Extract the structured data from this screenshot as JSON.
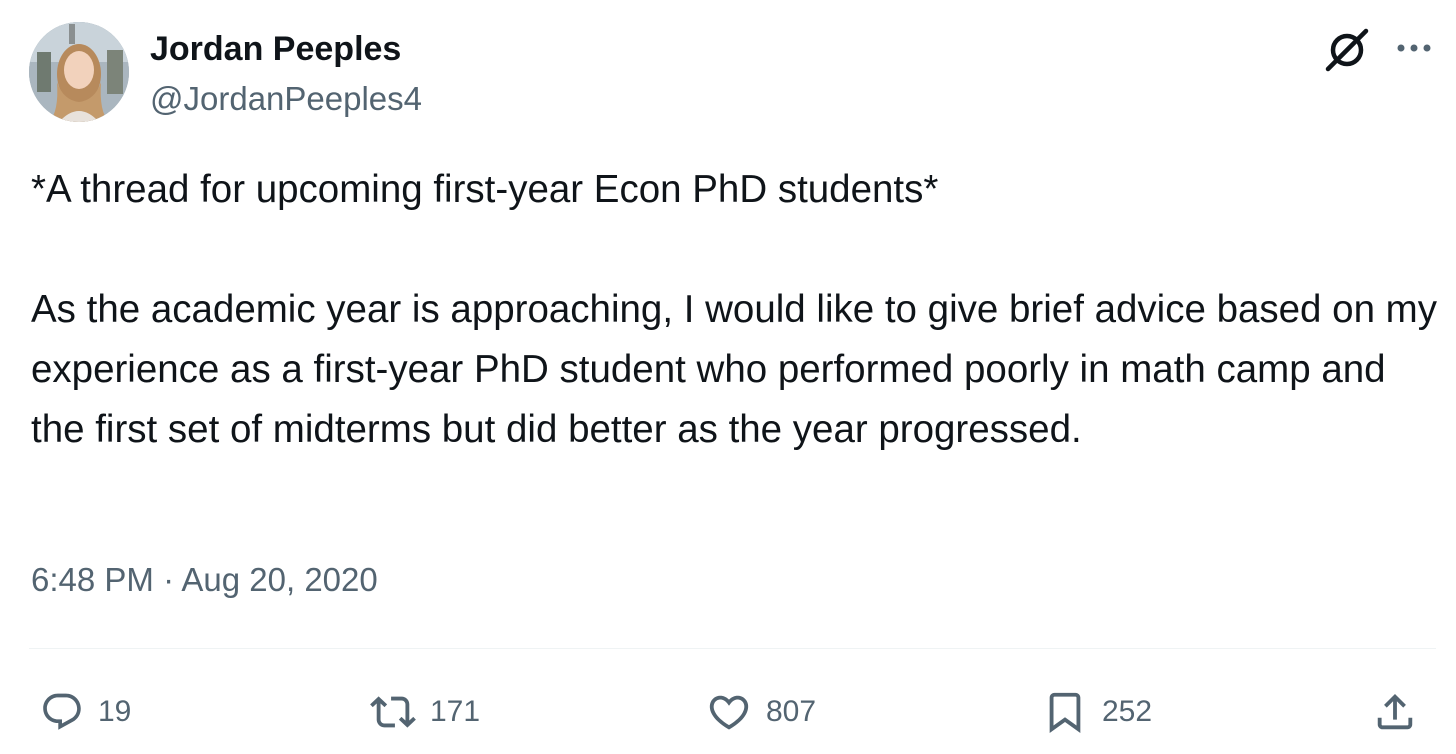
{
  "author": {
    "display_name": "Jordan Peeples",
    "handle": "@JordanPeeples4",
    "avatar": "avatar-photo"
  },
  "header_icons": [
    "grok-icon",
    "more-icon"
  ],
  "tweet": {
    "paragraph_1": "*A thread for upcoming first-year Econ PhD students*",
    "paragraph_2": "As the academic year is approaching, I would like to give brief advice based on my experience as a first-year PhD student who performed poorly in math camp and the first set of midterms but did better as the year progressed.",
    "timestamp": "6:48 PM · Aug 20, 2020"
  },
  "actions": {
    "replies": "19",
    "retweets": "171",
    "likes": "807",
    "bookmarks": "252"
  },
  "colors": {
    "text": "#0f1419",
    "secondary": "#536471",
    "divider": "#eff3f4"
  }
}
